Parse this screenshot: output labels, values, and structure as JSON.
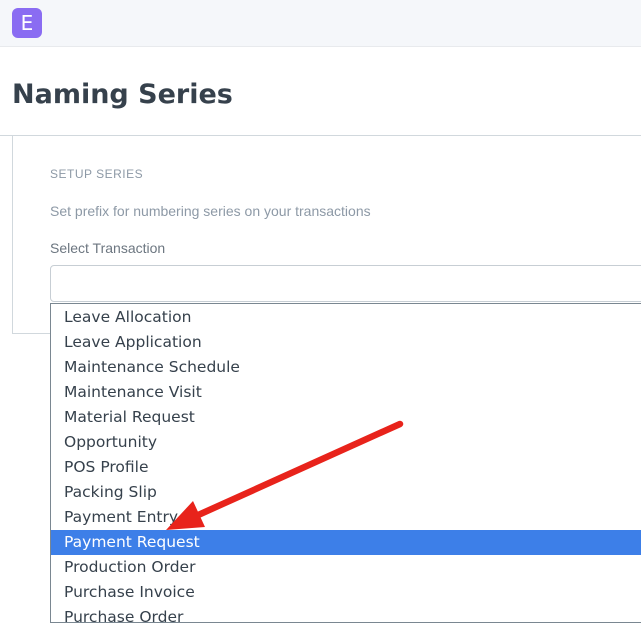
{
  "app": {
    "logo_letter": "E",
    "logo_color": "#8a6cf2"
  },
  "page": {
    "title": "Naming Series"
  },
  "setup": {
    "section_title": "SETUP SERIES",
    "description": "Set prefix for numbering series on your transactions",
    "select_label": "Select Transaction",
    "select_value": ""
  },
  "dropdown": {
    "selected_color": "#3d7fe8",
    "options": [
      "Leave Allocation",
      "Leave Application",
      "Maintenance Schedule",
      "Maintenance Visit",
      "Material Request",
      "Opportunity",
      "POS Profile",
      "Packing Slip",
      "Payment Entry",
      "Payment Request",
      "Production Order",
      "Purchase Invoice",
      "Purchase Order"
    ],
    "selected_option": "Payment Request"
  },
  "annotation": {
    "arrow_color": "#e8231b"
  }
}
